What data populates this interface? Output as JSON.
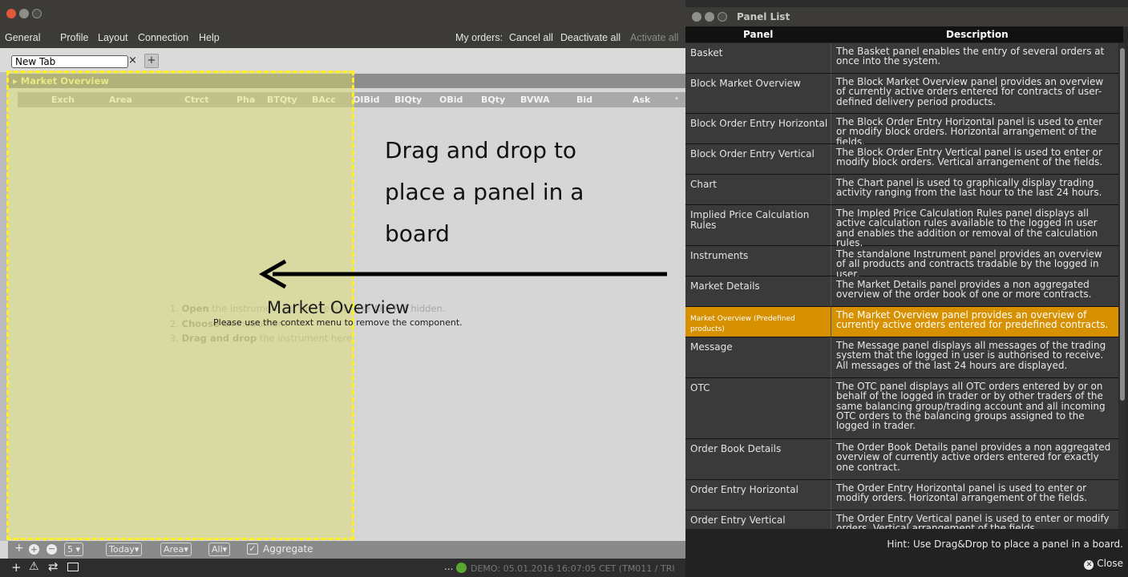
{
  "menu": {
    "general": "General",
    "profile": "Profile",
    "layout": "Layout",
    "connection": "Connection",
    "help": "Help",
    "my_orders_label": "My orders:",
    "cancel_all": "Cancel all",
    "deactivate_all": "Deactivate all",
    "activate_all": "Activate all"
  },
  "tabs": {
    "current_tab_value": "New Tab",
    "close_glyph": "×",
    "add_glyph": "+"
  },
  "panel": {
    "title": "Market Overview",
    "columns": [
      "Exch",
      "Area",
      "Ctrct",
      "Pha",
      "BTQty",
      "BAcc",
      "OIBid",
      "BIQty",
      "OBid",
      "BQty",
      "BVWA",
      "Bid",
      "Ask"
    ],
    "column_config_glyph": "⁺"
  },
  "instructions": {
    "step1_num": "1.",
    "step1_bold": "Open",
    "step1_rest": "the instrument list on the left. Use Alt+P if hidden.",
    "step2_num": "2.",
    "step2_bold": "Choose",
    "step2_rest": "an instrument",
    "step3_num": "3.",
    "step3_bold": "Drag and drop",
    "step3_rest": "the instrument here"
  },
  "drop_zone": {
    "label": "Market Overview",
    "hint": "Please use the context menu to remove the component."
  },
  "overlay_text": {
    "drag_line1": "Drag and drop to",
    "drag_line2": "place a panel in a",
    "drag_line3": "board"
  },
  "footer": {
    "add_glyph": "+",
    "depth_value": "5",
    "period_value": "Today",
    "area_value": "Area",
    "filter_value": "All",
    "aggregate_label": "Aggregate",
    "status_text": "DEMO: 05.01.2016 16:07:05 CET (TM011 / TRI"
  },
  "panel_list": {
    "title": "Panel List",
    "col_panel": "Panel",
    "col_description": "Description",
    "rows": [
      {
        "panel": "Basket",
        "description": "The Basket panel enables the entry of several orders at once into the system."
      },
      {
        "panel": "Block Market Overview",
        "description": "The Block Market Overview panel provides an overview of currently active orders entered for contracts of user-defined delivery period products."
      },
      {
        "panel": "Block Order Entry Horizontal",
        "description": "The Block Order Entry Horizontal panel is used to enter or modify block orders. Horizontal arrangement of the fields."
      },
      {
        "panel": "Block Order Entry Vertical",
        "description": "The Block Order Entry Vertical panel is used to enter or modify block orders. Vertical arrangement of the fields."
      },
      {
        "panel": "Chart",
        "description": "The Chart panel is used to graphically display trading activity ranging from the last hour to the last 24 hours."
      },
      {
        "panel": "Implied Price Calculation Rules",
        "description": "The Impled Price Calculation Rules panel displays all active calculation rules available to the logged in user and enables the addition or removal of the calculation rules."
      },
      {
        "panel": "Instruments",
        "description": "The standalone Instrument panel provides an overview of all products and contracts tradable by the logged in user."
      },
      {
        "panel": "Market Details",
        "description": "The Market Details panel provides a non aggregated overview of the order book of one or more contracts."
      },
      {
        "panel": "Market Overview (Predefined products)",
        "description": "The Market Overview panel provides an overview of currently active orders entered for predefined contracts."
      },
      {
        "panel": "Message",
        "description": "The Message panel displays all messages of the trading system that the logged in user is authorised to receive. All messages of the last 24 hours are displayed."
      },
      {
        "panel": "OTC",
        "description": "The OTC panel displays all OTC orders entered by or on behalf of the logged in trader or by other traders of the same balancing group/trading account and all incoming OTC orders to the balancing groups assigned to the logged in trader."
      },
      {
        "panel": "Order Book Details",
        "description": "The Order Book Details panel provides a non aggregated overview of currently active orders entered for exactly one contract."
      },
      {
        "panel": "Order Entry Horizontal",
        "description": "The Order Entry Horizontal panel is used to enter or modify orders. Horizontal arrangement of the fields."
      },
      {
        "panel": "Order Entry Vertical",
        "description": "The Order Entry Vertical panel is used to enter or modify orders. Vertical arrangement of the fields."
      }
    ],
    "hint": "Hint: Use Drag&Drop to place a panel in a board.",
    "close_label": "Close"
  },
  "colors": {
    "selection": "#d69000",
    "drop_border": "#ffee22",
    "panel_title": "#f0f0a0"
  }
}
